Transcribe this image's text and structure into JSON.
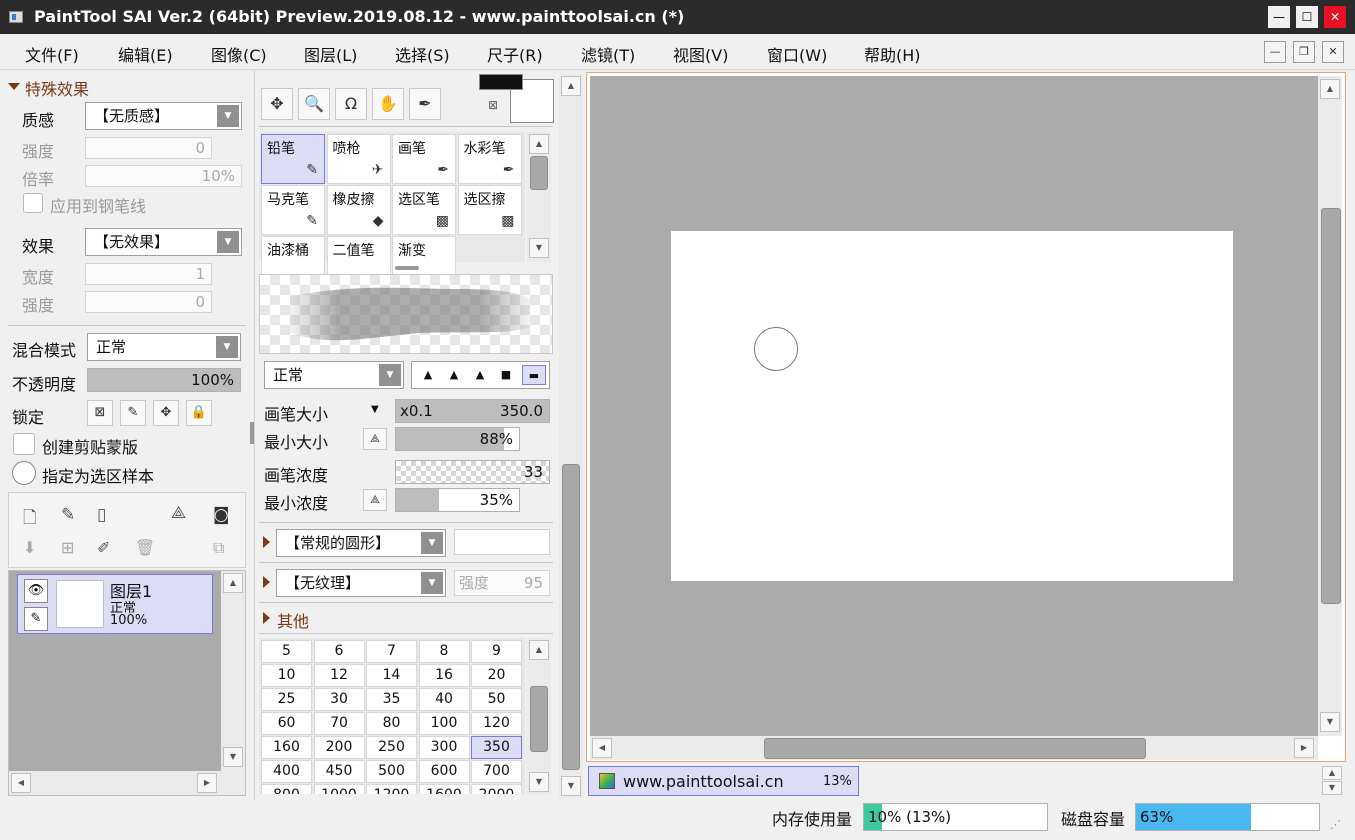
{
  "window": {
    "title": "PaintTool SAI Ver.2 (64bit) Preview.2019.08.12 - www.painttoolsai.cn (*)",
    "minimize": "—",
    "maximize": "☐",
    "close": "✕"
  },
  "menu": [
    "文件(F)",
    "编辑(E)",
    "图像(C)",
    "图层(L)",
    "选择(S)",
    "尺子(R)",
    "滤镜(T)",
    "视图(V)",
    "窗口(W)",
    "帮助(H)"
  ],
  "mdi": {
    "minimize": "—",
    "restore": "❐",
    "close": "✕"
  },
  "effects": {
    "header": "特殊效果",
    "texture_label": "质感",
    "texture_value": "【无质感】",
    "strength_label": "强度",
    "strength_value": "0",
    "scale_label": "倍率",
    "scale_value": "10%",
    "apply_pen": "应用到钢笔线",
    "effect_label": "效果",
    "effect_value": "【无效果】",
    "width_label": "宽度",
    "width_value": "1",
    "strength2_label": "强度",
    "strength2_value": "0"
  },
  "layer_props": {
    "blend_label": "混合模式",
    "blend_value": "正常",
    "opacity_label": "不透明度",
    "opacity_value": "100%",
    "opacity": 1.0,
    "lock_label": "锁定",
    "clip_label": "创建剪贴蒙版",
    "sample_label": "指定为选区样本"
  },
  "layers": [
    {
      "name": "图层1",
      "mode": "正常",
      "opacity": "100%"
    }
  ],
  "tools": {
    "brushes": [
      {
        "name": "铅笔",
        "icon": "✎",
        "selected": true
      },
      {
        "name": "喷枪",
        "icon": "✈",
        "selected": false
      },
      {
        "name": "画笔",
        "icon": "✒",
        "selected": false
      },
      {
        "name": "水彩笔",
        "icon": "✒",
        "selected": false
      },
      {
        "name": "马克笔",
        "icon": "✎",
        "selected": false
      },
      {
        "name": "橡皮擦",
        "icon": "◆",
        "selected": false
      },
      {
        "name": "选区笔",
        "icon": "▩",
        "selected": false
      },
      {
        "name": "选区擦",
        "icon": "▩",
        "selected": false
      },
      {
        "name": "油漆桶",
        "icon": "",
        "selected": false
      },
      {
        "name": "二值笔",
        "icon": "",
        "selected": false
      },
      {
        "name": "渐变",
        "icon": "",
        "selected": false
      }
    ],
    "blend_mode": "正常",
    "brush_size_label": "画笔大小",
    "brush_size_mult": "x0.1",
    "brush_size_value": "350.0",
    "min_size_label": "最小大小",
    "min_size_value": "88%",
    "min_size": 0.88,
    "density_label": "画笔浓度",
    "density_value": "33",
    "min_density_label": "最小浓度",
    "min_density_value": "35%",
    "min_density": 0.35,
    "shape_value": "【常规的圆形】",
    "texture_value": "【无纹理】",
    "texture_strength_label": "强度",
    "texture_strength_value": "95",
    "other_label": "其他",
    "sizes": [
      "5",
      "6",
      "7",
      "8",
      "9",
      "10",
      "12",
      "14",
      "16",
      "20",
      "25",
      "30",
      "35",
      "40",
      "50",
      "60",
      "70",
      "80",
      "100",
      "120",
      "160",
      "200",
      "250",
      "300",
      "350",
      "400",
      "450",
      "500",
      "600",
      "700",
      "800",
      "1000",
      "1200",
      "1600",
      "2000"
    ],
    "selected_size": "350"
  },
  "document_tab": {
    "name": "www.painttoolsai.cn",
    "zoom": "13%"
  },
  "status": {
    "memory_label": "内存使用量",
    "memory_value": "10% (13%)",
    "memory": 0.1,
    "disk_label": "磁盘容量",
    "disk_value": "63%",
    "disk": 0.63
  }
}
